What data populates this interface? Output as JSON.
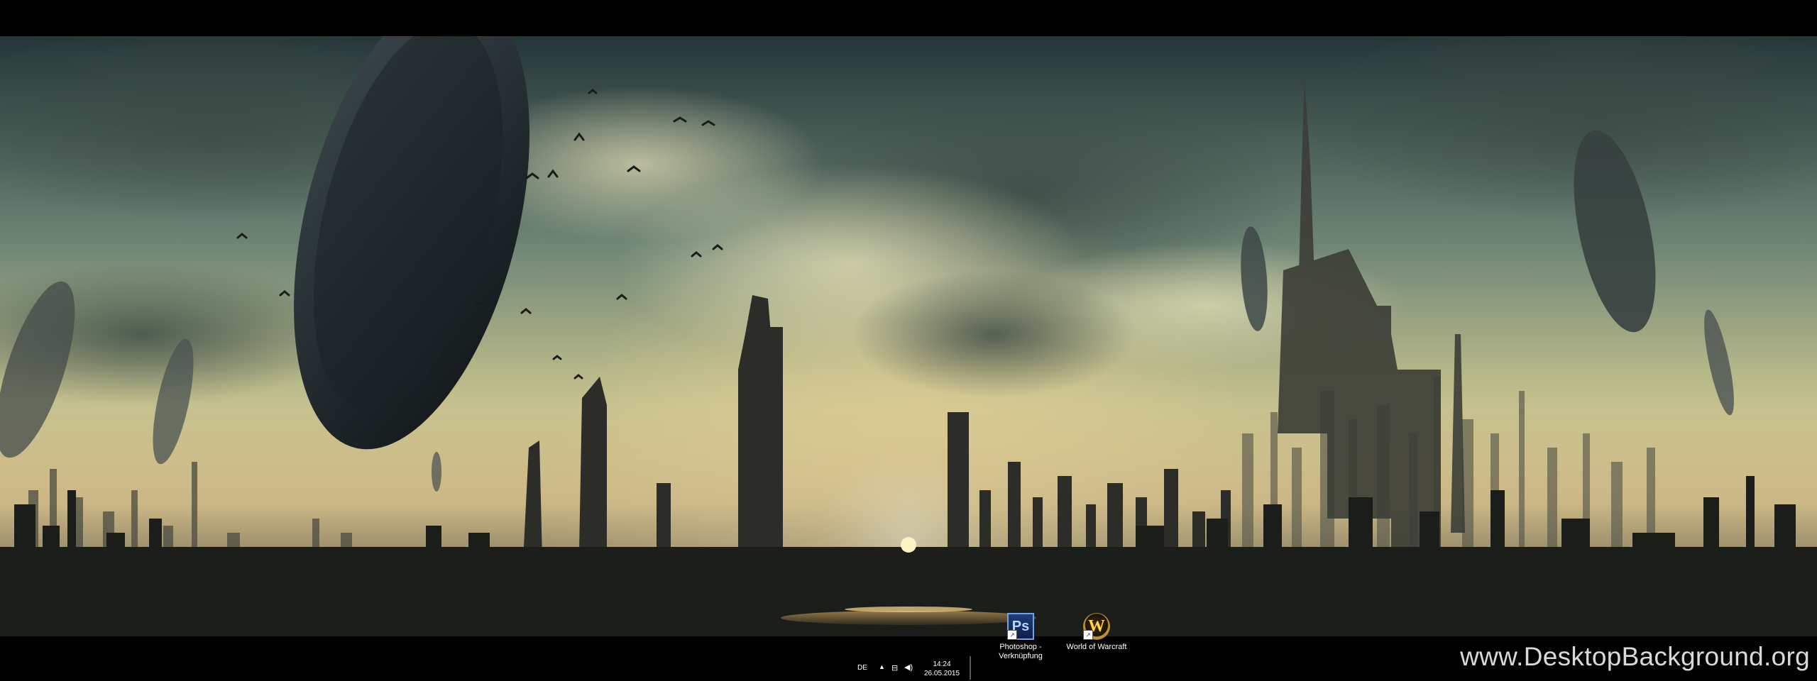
{
  "desktop": {
    "icons": [
      {
        "label": "Photoshop -\nVerknüpfung",
        "glyph": "Ps",
        "icon": "photoshop-icon"
      },
      {
        "label": "World of Warcraft",
        "glyph": "W",
        "icon": "world-of-warcraft-icon"
      }
    ]
  },
  "taskbar": {
    "language": "DE",
    "tray_chevron": "▲",
    "network_glyph": "⊟",
    "volume_glyph": "◀)",
    "time": "14:24",
    "date": "26.05.2015"
  },
  "watermark": "www.DesktopBackground.org",
  "colors": {
    "sky_top": "#2f4748",
    "sky_glow": "#d9d49a",
    "city_silhouette": "#1c1f1e",
    "sun": "#fff2c4"
  }
}
